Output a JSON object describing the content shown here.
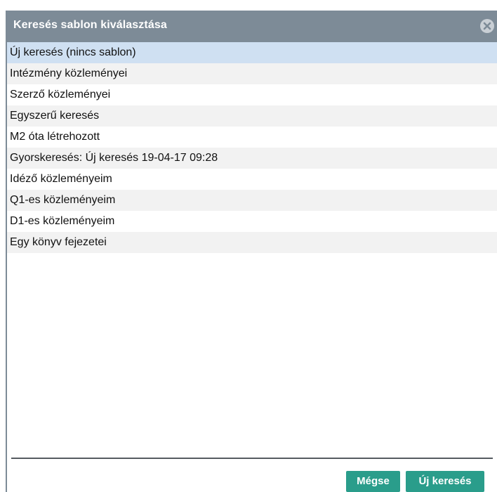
{
  "dialog": {
    "title": "Keresés sablon kiválasztása",
    "close_icon": "close-icon"
  },
  "templates": {
    "selected_index": 0,
    "items": [
      "Új keresés (nincs sablon)",
      "Intézmény közleményei",
      "Szerző közleményei",
      "Egyszerű keresés",
      "M2 óta létrehozott",
      "Gyorskeresés: Új keresés 19-04-17 09:28",
      "Idéző közleményeim",
      "Q1-es közleményeim",
      "D1-es közleményeim",
      "Egy könyv fejezetei"
    ]
  },
  "footer": {
    "cancel_label": "Mégse",
    "new_search_label": "Új keresés"
  },
  "colors": {
    "titlebar": "#7d8b97",
    "selected_row": "#cfe0f2",
    "alt_row": "#f2f2f2",
    "button": "#2a9d8b"
  }
}
